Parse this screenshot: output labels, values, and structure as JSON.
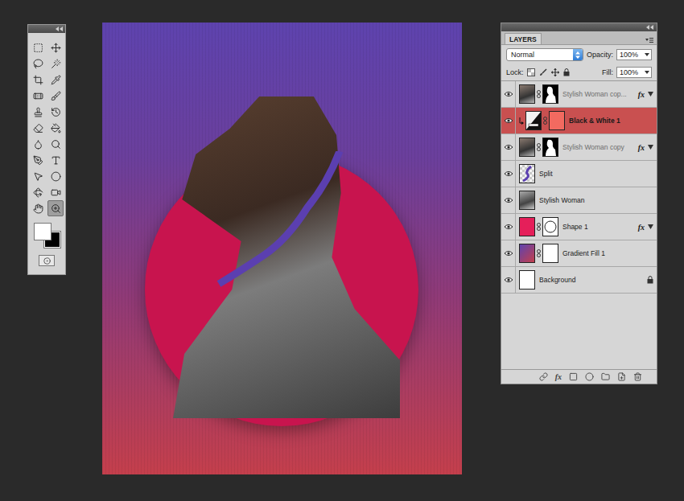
{
  "tools_palette": {
    "tools": [
      {
        "selected": false
      },
      {
        "selected": false
      },
      {
        "selected": false
      },
      {
        "selected": false
      },
      {
        "selected": false
      },
      {
        "selected": false
      },
      {
        "selected": false
      },
      {
        "selected": false
      },
      {
        "selected": false
      },
      {
        "selected": false
      },
      {
        "selected": false
      },
      {
        "selected": false
      },
      {
        "selected": false
      },
      {
        "selected": false
      },
      {
        "selected": false
      },
      {
        "selected": false
      },
      {
        "selected": false
      },
      {
        "selected": false
      },
      {
        "selected": false
      },
      {
        "selected": false
      },
      {
        "selected": false
      },
      {
        "selected": true
      }
    ],
    "swatches": [
      {
        "name": "foreground",
        "color": "#ffffff"
      },
      {
        "name": "background",
        "color": "#000000"
      }
    ]
  },
  "layers_panel": {
    "tab": "LAYERS",
    "blend_mode": "Normal",
    "opacity_label": "Opacity:",
    "opacity": "100%",
    "lock_label": "Lock:",
    "fill_label": "Fill:",
    "fill": "100%",
    "footer_fx": "fx",
    "layers": [
      {
        "name": "Stylish Woman cop...",
        "kind": "masked",
        "fx": "fx",
        "visible": true,
        "selected": false,
        "dimmed": true,
        "locked": false
      },
      {
        "name": "Black & White 1",
        "kind": "adjustment",
        "fx": "",
        "visible": true,
        "selected": true,
        "dimmed": false,
        "locked": false
      },
      {
        "name": "Stylish Woman copy",
        "kind": "masked",
        "fx": "fx",
        "visible": true,
        "selected": false,
        "dimmed": true,
        "locked": false
      },
      {
        "name": "Split",
        "kind": "split",
        "fx": "",
        "visible": true,
        "selected": false,
        "dimmed": false,
        "locked": false
      },
      {
        "name": "Stylish Woman",
        "kind": "pixel",
        "fx": "",
        "visible": true,
        "selected": false,
        "dimmed": false,
        "locked": false
      },
      {
        "name": "Shape 1",
        "kind": "shape",
        "fx": "fx",
        "visible": true,
        "selected": false,
        "dimmed": false,
        "locked": false
      },
      {
        "name": "Gradient Fill 1",
        "kind": "fill",
        "fx": "",
        "visible": true,
        "selected": false,
        "dimmed": false,
        "locked": false
      },
      {
        "name": "Background",
        "kind": "background",
        "fx": "",
        "visible": true,
        "selected": false,
        "dimmed": false,
        "locked": true
      }
    ]
  }
}
